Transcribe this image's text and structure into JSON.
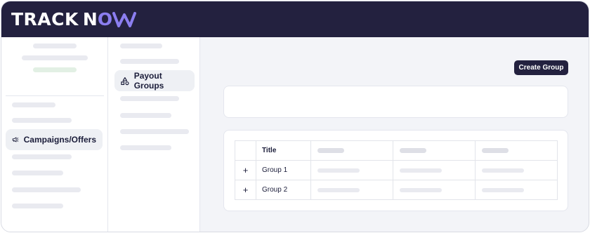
{
  "brand": {
    "track": "TRACK",
    "now": "NO",
    "now_w": "W"
  },
  "sidebar": {
    "active_item": {
      "label": "Campaigns/Offers",
      "icon": "megaphone-icon"
    }
  },
  "subnav": {
    "active_item": {
      "label": "Payout Groups",
      "icon": "shapes-icon"
    }
  },
  "main": {
    "create_button": "Create Group",
    "table": {
      "header_title": "Title",
      "rows": [
        {
          "expand": "+",
          "title": "Group 1"
        },
        {
          "expand": "+",
          "title": "Group 2"
        }
      ]
    }
  },
  "colors": {
    "header_bg": "#23213f",
    "accent": "#8b7ef0",
    "button_bg": "#23213f"
  }
}
